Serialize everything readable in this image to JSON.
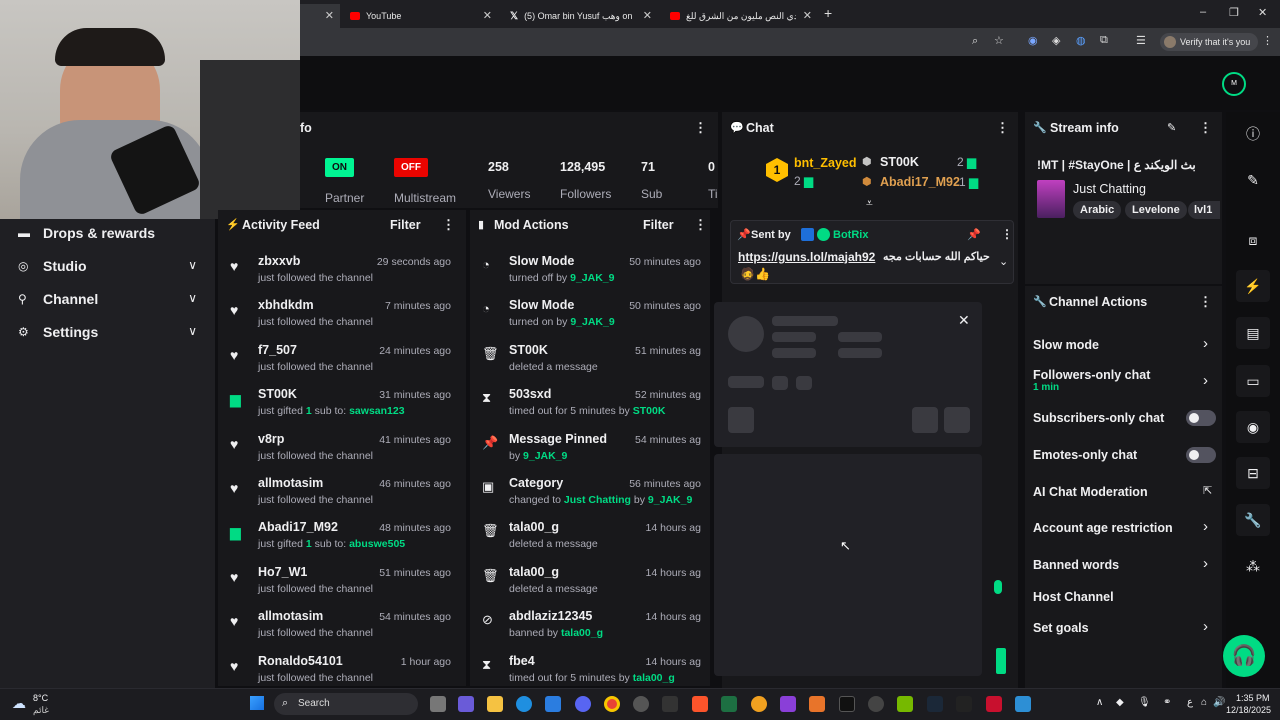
{
  "browser": {
    "tabs": [
      {
        "title": "YouTube"
      },
      {
        "title": "(5) Omar bin Yusuf وهب on X: \""
      },
      {
        "title": "تحدي النص مليون من الشرق للغ"
      }
    ],
    "new_tab": "+",
    "profile": "Verify that it's you",
    "window_controls": [
      "–",
      "❐",
      "✕"
    ]
  },
  "left_nav": {
    "items": [
      {
        "label": "Drops & rewards",
        "icon": "drops-icon"
      },
      {
        "label": "Studio",
        "icon": "studio-icon"
      },
      {
        "label": "Channel",
        "icon": "channel-icon"
      },
      {
        "label": "Settings",
        "icon": "settings-icon"
      }
    ]
  },
  "stream_stats": {
    "title_fragment": "fo",
    "partner": {
      "badge": "ON",
      "label": "Partner"
    },
    "multistream": {
      "badge": "OFF",
      "label": "Multistream"
    },
    "viewers": {
      "value": "258",
      "label": "Viewers"
    },
    "followers": {
      "value": "128,495",
      "label": "Followers"
    },
    "subs": {
      "value": "71",
      "label": "Sub"
    },
    "extra": {
      "value": "0",
      "label": "Ti"
    }
  },
  "activity_feed": {
    "title": "Activity Feed",
    "filter": "Filter",
    "items": [
      {
        "name": "zbxxvb",
        "time": "29 seconds ago",
        "pre": "just followed the channel",
        "target": "",
        "kind": "follow"
      },
      {
        "name": "xbhdkdm",
        "time": "7 minutes ago",
        "pre": "just followed the channel",
        "target": "",
        "kind": "follow"
      },
      {
        "name": "f7_507",
        "time": "24 minutes ago",
        "pre": "just followed the channel",
        "target": "",
        "kind": "follow"
      },
      {
        "name": "ST00K",
        "time": "31 minutes ago",
        "pre": "just gifted",
        "count": "1",
        "mid": "sub to:",
        "target": "sawsan123",
        "kind": "gift"
      },
      {
        "name": "v8rp",
        "time": "41 minutes ago",
        "pre": "just followed the channel",
        "target": "",
        "kind": "follow"
      },
      {
        "name": "allmotasim",
        "time": "46 minutes ago",
        "pre": "just followed the channel",
        "target": "",
        "kind": "follow"
      },
      {
        "name": "Abadi17_M92",
        "time": "48 minutes ago",
        "pre": "just gifted",
        "count": "1",
        "mid": "sub to:",
        "target": "abuswe505",
        "kind": "gift"
      },
      {
        "name": "Ho7_W1",
        "time": "51 minutes ago",
        "pre": "just followed the channel",
        "target": "",
        "kind": "follow"
      },
      {
        "name": "allmotasim",
        "time": "54 minutes ago",
        "pre": "just followed the channel",
        "target": "",
        "kind": "follow"
      },
      {
        "name": "Ronaldo54101",
        "time": "1 hour ago",
        "pre": "just followed the channel",
        "target": "",
        "kind": "follow"
      }
    ]
  },
  "mod_actions": {
    "title": "Mod Actions",
    "filter": "Filter",
    "items": [
      {
        "name": "Slow Mode",
        "time": "50 minutes ago",
        "pre": "turned off by",
        "hl": "",
        "by": "9_JAK_9",
        "icon": "slow-mode-icon",
        "glyph": "◔"
      },
      {
        "name": "Slow Mode",
        "time": "50 minutes ago",
        "pre": "turned on by",
        "hl": "",
        "by": "9_JAK_9",
        "icon": "slow-mode-icon",
        "glyph": "◔"
      },
      {
        "name": "ST00K",
        "time": "51 minutes ag",
        "pre": "deleted a message",
        "hl": "",
        "by": "",
        "icon": "trash-icon",
        "glyph": "🗑"
      },
      {
        "name": "503sxd",
        "time": "52 minutes ag",
        "pre": "timed out for 5 minutes by",
        "hl": "",
        "by": "ST00K",
        "icon": "hourglass-icon",
        "glyph": "⧗"
      },
      {
        "name": "Message Pinned",
        "time": "54 minutes ag",
        "pre": "by",
        "hl": "",
        "by": "9_JAK_9",
        "icon": "pin-icon",
        "glyph": "📌"
      },
      {
        "name": "Category",
        "time": "56 minutes ago",
        "pre": "changed to",
        "hl": "Just Chatting",
        "by": "9_JAK_9",
        "icon": "category-icon",
        "glyph": "▣"
      },
      {
        "name": "tala00_g",
        "time": "14 hours ag",
        "pre": "deleted a message",
        "hl": "",
        "by": "",
        "icon": "trash-icon",
        "glyph": "🗑"
      },
      {
        "name": "tala00_g",
        "time": "14 hours ag",
        "pre": "deleted a message",
        "hl": "",
        "by": "",
        "icon": "trash-icon",
        "glyph": "🗑"
      },
      {
        "name": "abdlaziz12345",
        "time": "14 hours ag",
        "pre": "banned by",
        "hl": "",
        "by": "tala00_g",
        "icon": "ban-icon",
        "glyph": "⊘"
      },
      {
        "name": "fbe4",
        "time": "14 hours ag",
        "pre": "timed out for 5 minutes by",
        "hl": "",
        "by": "tala00_g",
        "icon": "hourglass-icon",
        "glyph": "⧗"
      }
    ]
  },
  "chat": {
    "title": "Chat",
    "leaderboard": {
      "first": {
        "rank": "1",
        "name": "bnt_Zayed",
        "count": "2"
      },
      "second": {
        "name": "ST00K",
        "count": "2"
      },
      "third": {
        "name": "Abadi17_M92",
        "count": "1"
      }
    },
    "pinned": {
      "sent_by": "Sent by",
      "bot": "BotRix",
      "link": "https://guns.lol/majah92",
      "text": "حياكم الله حسابات مجه"
    }
  },
  "stream_info": {
    "title": "Stream info",
    "stream_title": "!MT | #StayOne | بث الويكند ع",
    "category": "Just Chatting",
    "tags": [
      "Arabic",
      "Levelone",
      "lvl1"
    ]
  },
  "channel_actions": {
    "title": "Channel Actions",
    "slow_mode": "Slow mode",
    "followers_only": "Followers-only chat",
    "followers_only_sub": "1 min",
    "subscribers_only": "Subscribers-only chat",
    "emotes_only": "Emotes-only chat",
    "ai_moderation": "AI Chat Moderation",
    "account_age": "Account age restriction",
    "banned_words": "Banned words",
    "host_channel": "Host Channel",
    "set_goals": "Set goals"
  },
  "taskbar": {
    "weather_temp": "8°C",
    "weather_desc": "غائم",
    "search": "Search",
    "lang": "ع",
    "time": "1:35 PM",
    "date": "12/18/2025"
  },
  "colors": {
    "accent_green": "#00db84",
    "on_badge": "#00f593",
    "off_badge": "#eb0400",
    "gold": "#ffbf00",
    "panel": "#18181b"
  }
}
